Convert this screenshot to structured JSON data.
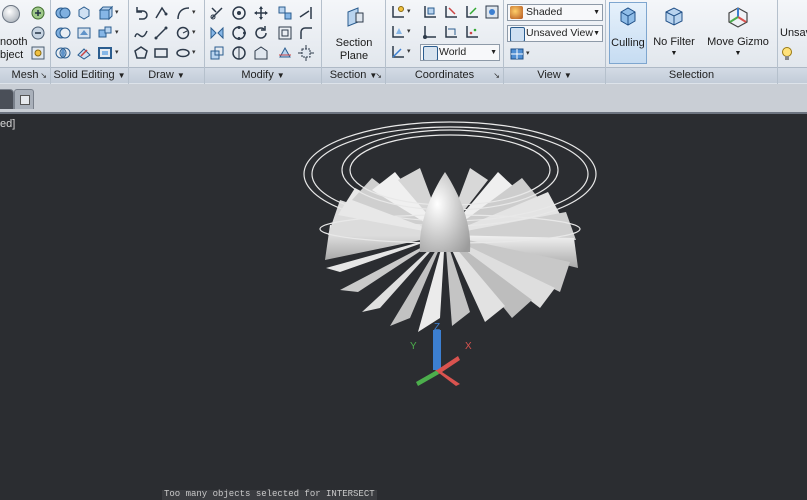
{
  "ribbon": {
    "mesh": {
      "big_label_line1": "nooth",
      "big_label_line2": "bject",
      "panel_label": "Mesh"
    },
    "solid_editing": {
      "panel_label": "Solid Editing"
    },
    "draw": {
      "panel_label": "Draw"
    },
    "modify": {
      "panel_label": "Modify"
    },
    "section": {
      "big_label_line1": "Section",
      "big_label_line2": "Plane",
      "panel_label": "Section"
    },
    "coordinates": {
      "ucs_combo": "World",
      "panel_label": "Coordinates"
    },
    "view": {
      "visual_style": "Shaded",
      "named_view": "Unsaved View",
      "panel_label": "View"
    },
    "selection": {
      "culling_label": "Culling",
      "filter_label": "No Filter",
      "gizmo_label": "Move Gizmo",
      "panel_label": "Selection",
      "culling_active": true
    },
    "overflow": {
      "label": "Unsav"
    }
  },
  "viewport": {
    "corner_label": "ed]",
    "axis_x": "X",
    "axis_y": "Y",
    "axis_z": "Z",
    "command_message": "Too many objects selected for INTERSECT"
  },
  "colors": {
    "background": "#2b2d31",
    "ribbon": "#e6eaef",
    "highlight": "#cfe3f7",
    "axis_x": "#d9534f",
    "axis_y": "#4cae4c",
    "axis_z": "#3c7fd1"
  }
}
